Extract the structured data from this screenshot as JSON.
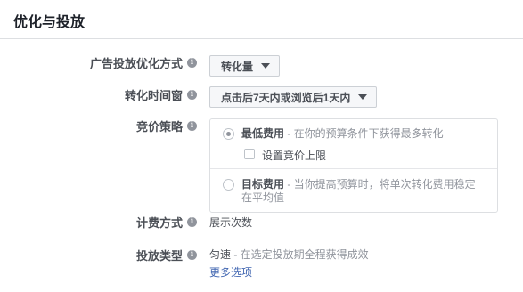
{
  "header": {
    "title": "优化与投放"
  },
  "optimization": {
    "label": "广告投放优化方式",
    "value": "转化量"
  },
  "conversion_window": {
    "label": "转化时间窗",
    "value": "点击后7天内或浏览后1天内"
  },
  "bid_strategy": {
    "label": "竞价策略",
    "lowest_cost": {
      "title": "最低费用",
      "desc": " - 在你的预算条件下获得最多转化",
      "selected": true
    },
    "bid_cap": {
      "label": "设置竞价上限",
      "checked": false
    },
    "target_cost": {
      "title": "目标费用",
      "desc_line1": " - 当你提高预算时，将单次转化费用稳定",
      "desc_line2": "在平均值",
      "selected": false
    }
  },
  "billing": {
    "label": "计费方式",
    "value": "展示次数"
  },
  "delivery_type": {
    "label": "投放类型",
    "value_title": "匀速",
    "value_desc": " - 在选定投放期全程获得成效",
    "more_link": "更多选项"
  },
  "icons": {
    "info": "info-icon",
    "dropdown": "caret-down-icon"
  },
  "colors": {
    "link": "#4267b2",
    "label": "#4b4f56",
    "muted": "#90949c"
  }
}
